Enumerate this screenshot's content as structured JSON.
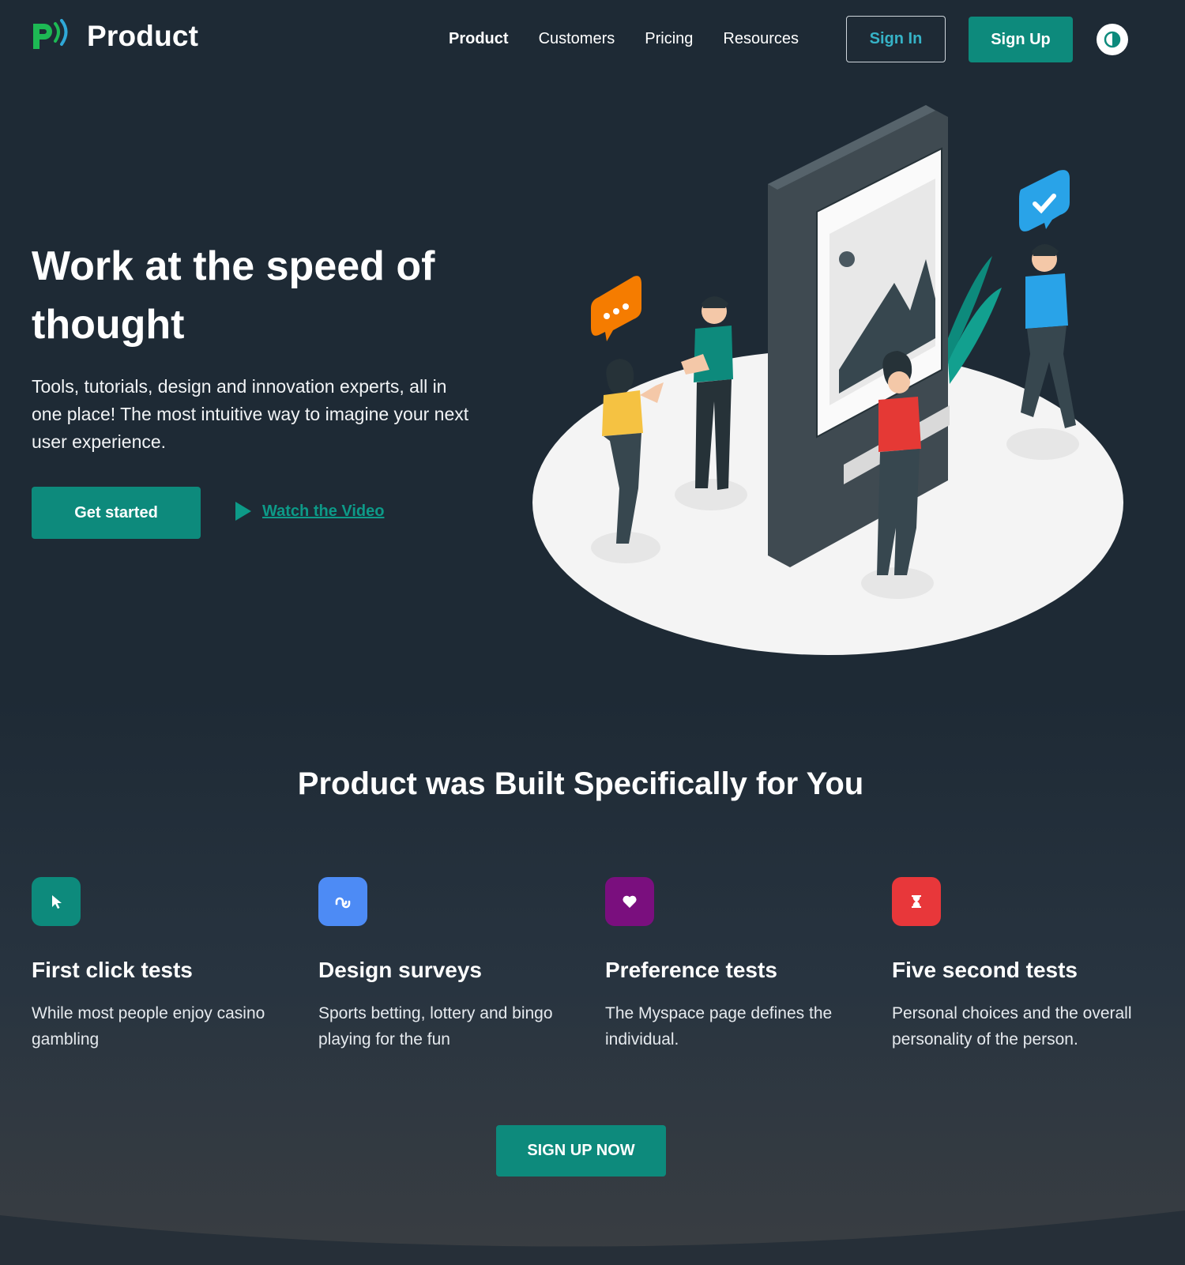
{
  "brand": {
    "name": "Product"
  },
  "nav": {
    "links": [
      {
        "label": "Product"
      },
      {
        "label": "Customers"
      },
      {
        "label": "Pricing"
      },
      {
        "label": "Resources"
      }
    ],
    "signin_label": "Sign In",
    "signup_label": "Sign Up"
  },
  "hero": {
    "title": "Work at the speed of thought",
    "subtitle": "Tools, tutorials, design and innovation experts, all in one place! The most intuitive way to imagine your next user experience.",
    "cta_label": "Get started",
    "video_label": "Watch the Video"
  },
  "features": {
    "title": "Product was Built Specifically for You",
    "items": [
      {
        "title": "First click tests",
        "desc": "While most people enjoy casino gambling",
        "icon": "cursor-icon",
        "color": "#0d8a7c"
      },
      {
        "title": "Design surveys",
        "desc": "Sports betting, lottery and bingo playing for the fun",
        "icon": "stumbleupon-icon",
        "color": "#4d8bf5"
      },
      {
        "title": "Preference tests",
        "desc": "The Myspace page defines the individual.",
        "icon": "heart-icon",
        "color": "#7a0f7e"
      },
      {
        "title": "Five second tests",
        "desc": "Personal choices and the overall personality of the person.",
        "icon": "hourglass-icon",
        "color": "#e8373a"
      }
    ],
    "cta_label": "SIGN UP NOW"
  },
  "colors": {
    "accent": "#0d8a7c",
    "background": "#1e2a35",
    "link": "#0d9a88",
    "signin_text": "#36b3c7"
  }
}
